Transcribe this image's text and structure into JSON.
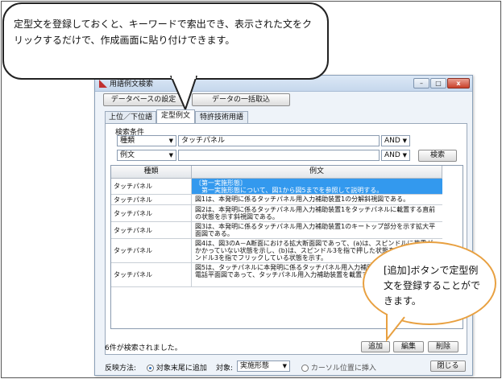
{
  "callout_top": {
    "text": "定型文を登録しておくと、キーワードで索出でき、表示された文をクリックするだけで、作成画面に貼り付けできます。"
  },
  "callout_right": {
    "text": "[追加]ボタンで定型例文を登録することができます。"
  },
  "window": {
    "title": "用語例文検索",
    "controls": {
      "minimize": "–",
      "maximize": "□",
      "close": "x"
    }
  },
  "toolbar": {
    "db_settings": "データベースの設定",
    "bulk_import": "データの一括取込"
  },
  "tabs": [
    {
      "label": "上位／下位語"
    },
    {
      "label": "定型例文"
    },
    {
      "label": "特許技術用語"
    }
  ],
  "search": {
    "section_label": "検索条件",
    "row1": {
      "field": "種類",
      "value": "タッチパネル",
      "op": "AND"
    },
    "row2": {
      "field": "例文",
      "value": "",
      "op": "AND"
    },
    "search_button": "検索"
  },
  "table": {
    "columns": [
      "種類",
      "例文"
    ],
    "rows": [
      {
        "type": "タッチパネル",
        "text": "〔第一実施形態〕\n　第一実施形態について、図1から図5までを参照して説明する。"
      },
      {
        "type": "タッチパネル",
        "text": "図1は、本発明に係るタッチパネル用入力補助装置1の分解斜視図である。"
      },
      {
        "type": "タッチパネル",
        "text": "図2は、本発明に係るタッチパネル用入力補助装置1をタッチパネルに載置する直前の状態を示す斜視図である。"
      },
      {
        "type": "タッチパネル",
        "text": "図3は、本発明に係るタッチパネル用入力補助装置1のキートップ部分を示す拡大平面図である。"
      },
      {
        "type": "タッチパネル",
        "text": "図4は、図3のA－A断面における拡大断面図であって、(a)は、スピンドルに荷重がかかっていない状態を示し、(b)は、スピンドル3を指で押した状態を、(c)は、スピンドル3を指でフリックしている状態を示す。"
      },
      {
        "type": "タッチパネル",
        "text": "図5は、タッチパネルに本発明に係るタッチパネル用入力補助装置1を載置する携帯電話平面図であって、タッチパネル用入力補助装置を載置する前の状態を示す。"
      }
    ]
  },
  "status": "6件が検索されました。",
  "actions": {
    "add": "追加",
    "edit": "編集",
    "delete": "削除"
  },
  "bottom": {
    "reflect_label": "反映方法:",
    "append_label": "対象末尾に追加",
    "target_label": "対象:",
    "target_value": "実施形態",
    "cursor_label": "カーソル位置に挿入",
    "close_button": "閉じる"
  }
}
